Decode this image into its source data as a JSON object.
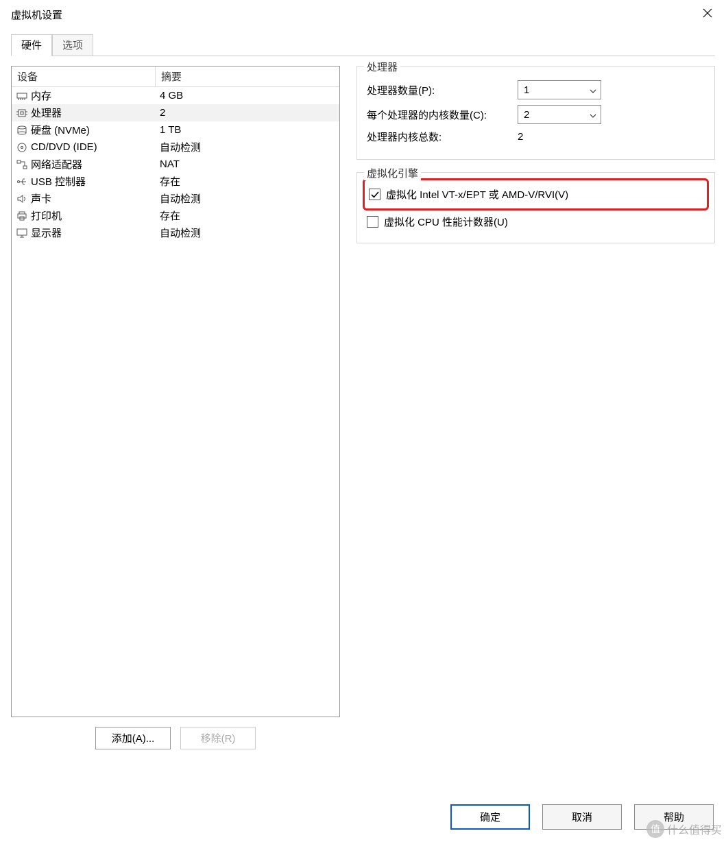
{
  "window": {
    "title": "虚拟机设置",
    "tabs": {
      "hardware": "硬件",
      "options": "选项"
    }
  },
  "device_list": {
    "header": {
      "device": "设备",
      "summary": "摘要"
    },
    "rows": [
      {
        "icon": "memory-icon",
        "name": "内存",
        "summary": "4 GB",
        "selected": false
      },
      {
        "icon": "cpu-icon",
        "name": "处理器",
        "summary": "2",
        "selected": true
      },
      {
        "icon": "disk-icon",
        "name": "硬盘 (NVMe)",
        "summary": "1 TB",
        "selected": false
      },
      {
        "icon": "cd-icon",
        "name": "CD/DVD (IDE)",
        "summary": "自动检测",
        "selected": false
      },
      {
        "icon": "net-icon",
        "name": "网络适配器",
        "summary": "NAT",
        "selected": false
      },
      {
        "icon": "usb-icon",
        "name": "USB 控制器",
        "summary": "存在",
        "selected": false
      },
      {
        "icon": "sound-icon",
        "name": "声卡",
        "summary": "自动检测",
        "selected": false
      },
      {
        "icon": "printer-icon",
        "name": "打印机",
        "summary": "存在",
        "selected": false
      },
      {
        "icon": "display-icon",
        "name": "显示器",
        "summary": "自动检测",
        "selected": false
      }
    ],
    "buttons": {
      "add": "添加(A)...",
      "remove": "移除(R)"
    }
  },
  "processors": {
    "group_title": "处理器",
    "fields": {
      "count_label": "处理器数量(P):",
      "count_value": "1",
      "cores_label": "每个处理器的内核数量(C):",
      "cores_value": "2",
      "total_label": "处理器内核总数:",
      "total_value": "2"
    }
  },
  "virt_engine": {
    "group_title": "虚拟化引擎",
    "vt_label": "虚拟化 Intel VT-x/EPT 或 AMD-V/RVI(V)",
    "vt_checked": true,
    "perf_label": "虚拟化 CPU 性能计数器(U)",
    "perf_checked": false
  },
  "dialog_buttons": {
    "ok": "确定",
    "cancel": "取消",
    "help": "帮助"
  },
  "watermark": "什么值得买"
}
